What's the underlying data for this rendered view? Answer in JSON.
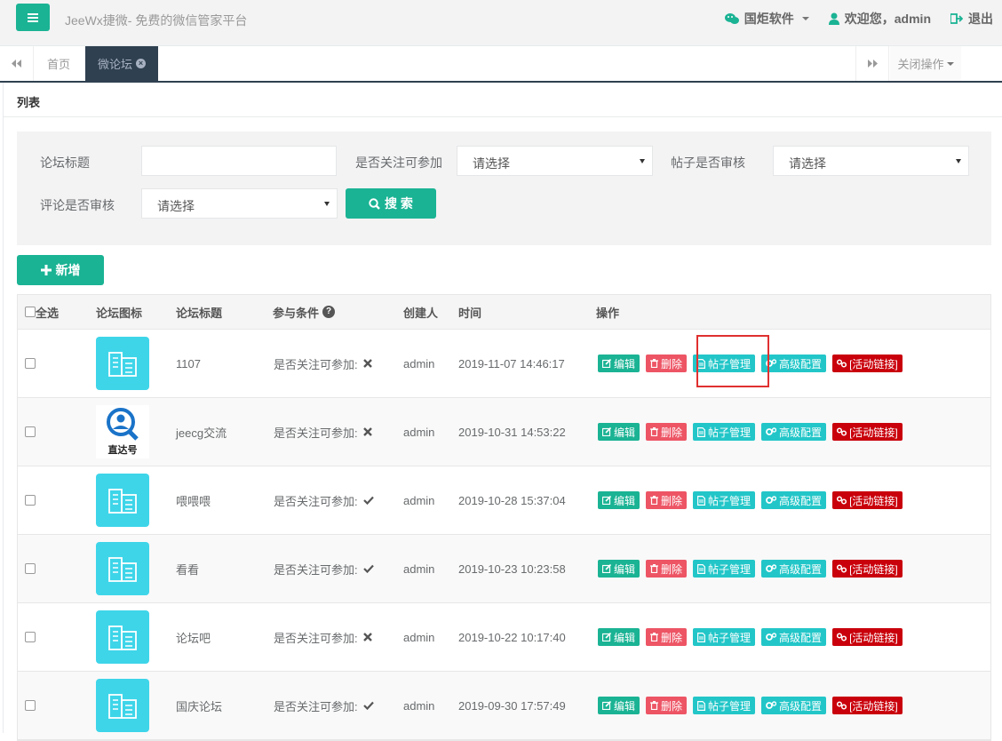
{
  "header": {
    "app_title": "JeeWx捷微- 免费的微信管家平台",
    "company": "国炬软件",
    "welcome": "欢迎您，admin",
    "logout": "退出"
  },
  "tabs": {
    "home": "首页",
    "active": "微论坛",
    "close_ops": "关闭操作"
  },
  "panel": {
    "title": "列表"
  },
  "search": {
    "forum_title_label": "论坛标题",
    "forum_title_value": "",
    "follow_label": "是否关注可参加",
    "follow_select": "请选择",
    "post_audit_label": "帖子是否审核",
    "post_audit_select": "请选择",
    "comment_audit_label": "评论是否审核",
    "comment_audit_select": "请选择",
    "search_button": "搜 索"
  },
  "toolbar": {
    "add_button": "新增"
  },
  "table": {
    "headers": {
      "select_all": "全选",
      "icon": "论坛图标",
      "title": "论坛标题",
      "condition": "参与条件",
      "creator": "创建人",
      "time": "时间",
      "actions": "操作"
    },
    "action_labels": {
      "edit": "编辑",
      "delete": "删除",
      "posts": "帖子管理",
      "config": "高级配置",
      "link": "[活动链接]"
    },
    "rows": [
      {
        "icon": "building-icon",
        "title": "1107",
        "condition": "是否关注可参加:",
        "follow": false,
        "creator": "admin",
        "time": "2019-11-07 14:46:17"
      },
      {
        "icon": "zhidahao-logo",
        "logo_text": "直达号",
        "title": "jeecg交流",
        "condition": "是否关注可参加:",
        "follow": false,
        "creator": "admin",
        "time": "2019-10-31 14:53:22"
      },
      {
        "icon": "building-icon",
        "title": "喂喂喂",
        "condition": "是否关注可参加:",
        "follow": true,
        "creator": "admin",
        "time": "2019-10-28 15:37:04"
      },
      {
        "icon": "building-icon",
        "title": "看看",
        "condition": "是否关注可参加:",
        "follow": true,
        "creator": "admin",
        "time": "2019-10-23 10:23:58"
      },
      {
        "icon": "building-icon",
        "title": "论坛吧",
        "condition": "是否关注可参加:",
        "follow": false,
        "creator": "admin",
        "time": "2019-10-22 10:17:40"
      },
      {
        "icon": "building-icon",
        "title": "国庆论坛",
        "condition": "是否关注可参加:",
        "follow": true,
        "creator": "admin",
        "time": "2019-09-30 17:57:49"
      }
    ]
  },
  "colors": {
    "primary": "#1ab394",
    "danger": "#ed5565",
    "info": "#23c6c8",
    "link": "#c9000b",
    "tab_active": "#2f4050",
    "forum_icon_bg": "#3ed5e9"
  }
}
